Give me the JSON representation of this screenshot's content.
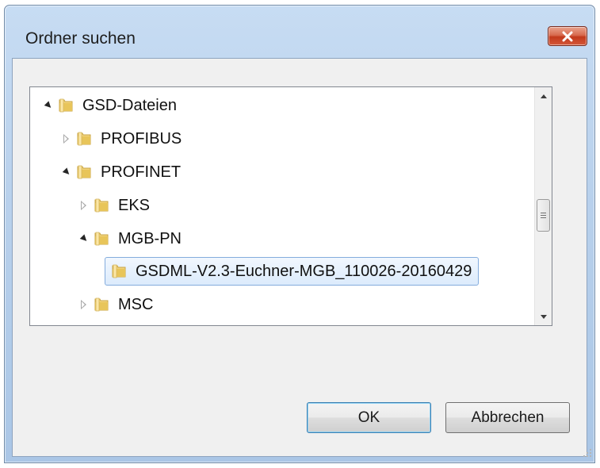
{
  "window": {
    "title": "Ordner suchen"
  },
  "tree": {
    "items": [
      {
        "label": "GSD-Dateien",
        "level": 0,
        "state": "expanded",
        "selected": false
      },
      {
        "label": "PROFIBUS",
        "level": 1,
        "state": "collapsed",
        "selected": false
      },
      {
        "label": "PROFINET",
        "level": 1,
        "state": "expanded",
        "selected": false
      },
      {
        "label": "EKS",
        "level": 2,
        "state": "collapsed",
        "selected": false
      },
      {
        "label": "MGB-PN",
        "level": 2,
        "state": "expanded",
        "selected": false
      },
      {
        "label": "GSDML-V2.3-Euchner-MGB_110026-20160429",
        "level": 3,
        "state": "leaf",
        "selected": true
      },
      {
        "label": "MSC",
        "level": 2,
        "state": "collapsed",
        "selected": false
      }
    ]
  },
  "buttons": {
    "ok_label": "OK",
    "cancel_label": "Abbrechen"
  },
  "colors": {
    "selection_border": "#84acdd",
    "folder_yellow": "#e8c55a",
    "close_red": "#c7402a"
  }
}
